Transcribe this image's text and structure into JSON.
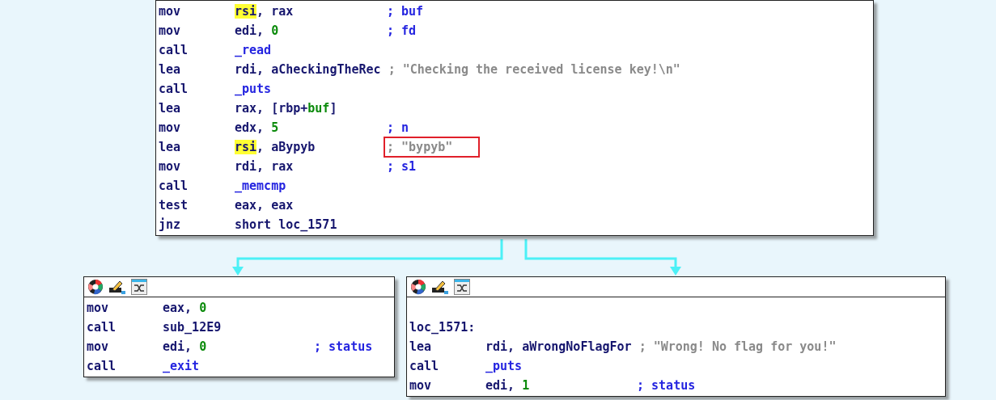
{
  "blocks": [
    {
      "header": false,
      "lines": [
        {
          "kind": "instr",
          "mnemonic": "mov",
          "operands": [
            {
              "text": "rsi",
              "kind": "highlighted"
            },
            {
              "text": ", rax",
              "kind": "plain"
            }
          ],
          "comment": {
            "text": "; buf",
            "kind": "comment",
            "boxed": false
          }
        },
        {
          "kind": "instr",
          "mnemonic": "mov",
          "operands": [
            {
              "text": "edi, ",
              "kind": "plain"
            },
            {
              "text": "0",
              "kind": "number"
            }
          ],
          "comment": {
            "text": "; fd",
            "kind": "comment",
            "boxed": false
          }
        },
        {
          "kind": "instr",
          "mnemonic": "call",
          "operands": [
            {
              "text": "_read",
              "kind": "symbol"
            }
          ]
        },
        {
          "kind": "instr",
          "mnemonic": "lea",
          "operands": [
            {
              "text": "rdi, aCheckingTheRec",
              "kind": "plain"
            }
          ],
          "comment": {
            "text": "; \"Checking the received license key!\\n\"",
            "kind": "string",
            "boxed": false
          }
        },
        {
          "kind": "instr",
          "mnemonic": "call",
          "operands": [
            {
              "text": "_puts",
              "kind": "symbol"
            }
          ]
        },
        {
          "kind": "instr",
          "mnemonic": "lea",
          "operands": [
            {
              "text": "rax, [rbp+",
              "kind": "plain"
            },
            {
              "text": "buf",
              "kind": "number"
            },
            {
              "text": "]",
              "kind": "plain"
            }
          ]
        },
        {
          "kind": "instr",
          "mnemonic": "mov",
          "operands": [
            {
              "text": "edx, ",
              "kind": "plain"
            },
            {
              "text": "5",
              "kind": "number"
            }
          ],
          "comment": {
            "text": "; n",
            "kind": "comment",
            "boxed": false
          }
        },
        {
          "kind": "instr",
          "mnemonic": "lea",
          "operands": [
            {
              "text": "rsi",
              "kind": "highlighted"
            },
            {
              "text": ", aBypyb",
              "kind": "plain"
            }
          ],
          "comment": {
            "text": "; \"bypyb\"",
            "kind": "string",
            "boxed": true
          }
        },
        {
          "kind": "instr",
          "mnemonic": "mov",
          "operands": [
            {
              "text": "rdi, rax",
              "kind": "plain"
            }
          ],
          "comment": {
            "text": "; s1",
            "kind": "comment",
            "boxed": false
          }
        },
        {
          "kind": "instr",
          "mnemonic": "call",
          "operands": [
            {
              "text": "_memcmp",
              "kind": "symbol"
            }
          ]
        },
        {
          "kind": "instr",
          "mnemonic": "test",
          "operands": [
            {
              "text": "eax, eax",
              "kind": "plain"
            }
          ]
        },
        {
          "kind": "instr",
          "mnemonic": "jnz",
          "operands": [
            {
              "text": "short loc_1571",
              "kind": "plain"
            }
          ]
        }
      ]
    },
    {
      "header": true,
      "lines": [
        {
          "kind": "instr",
          "mnemonic": "mov",
          "operands": [
            {
              "text": "eax, ",
              "kind": "plain"
            },
            {
              "text": "0",
              "kind": "number"
            }
          ]
        },
        {
          "kind": "instr",
          "mnemonic": "call",
          "operands": [
            {
              "text": "sub_12E9",
              "kind": "plain"
            }
          ]
        },
        {
          "kind": "instr",
          "mnemonic": "mov",
          "operands": [
            {
              "text": "edi, ",
              "kind": "plain"
            },
            {
              "text": "0",
              "kind": "number"
            }
          ],
          "comment": {
            "text": "; status",
            "kind": "comment",
            "boxed": false
          }
        },
        {
          "kind": "instr",
          "mnemonic": "call",
          "operands": [
            {
              "text": "_exit",
              "kind": "symbol"
            }
          ]
        }
      ]
    },
    {
      "header": true,
      "lines": [
        {
          "kind": "blank"
        },
        {
          "kind": "label",
          "text": "loc_1571:"
        },
        {
          "kind": "instr",
          "mnemonic": "lea",
          "operands": [
            {
              "text": "rdi, aWrongNoFlagFor",
              "kind": "plain"
            }
          ],
          "comment": {
            "text": "; \"Wrong! No flag for you!\"",
            "kind": "string",
            "boxed": false
          }
        },
        {
          "kind": "instr",
          "mnemonic": "call",
          "operands": [
            {
              "text": "_puts",
              "kind": "symbol"
            }
          ]
        },
        {
          "kind": "instr",
          "mnemonic": "mov",
          "operands": [
            {
              "text": "edi, ",
              "kind": "plain"
            },
            {
              "text": "1",
              "kind": "number"
            }
          ],
          "comment": {
            "text": "; status",
            "kind": "comment",
            "boxed": false
          }
        }
      ]
    }
  ]
}
